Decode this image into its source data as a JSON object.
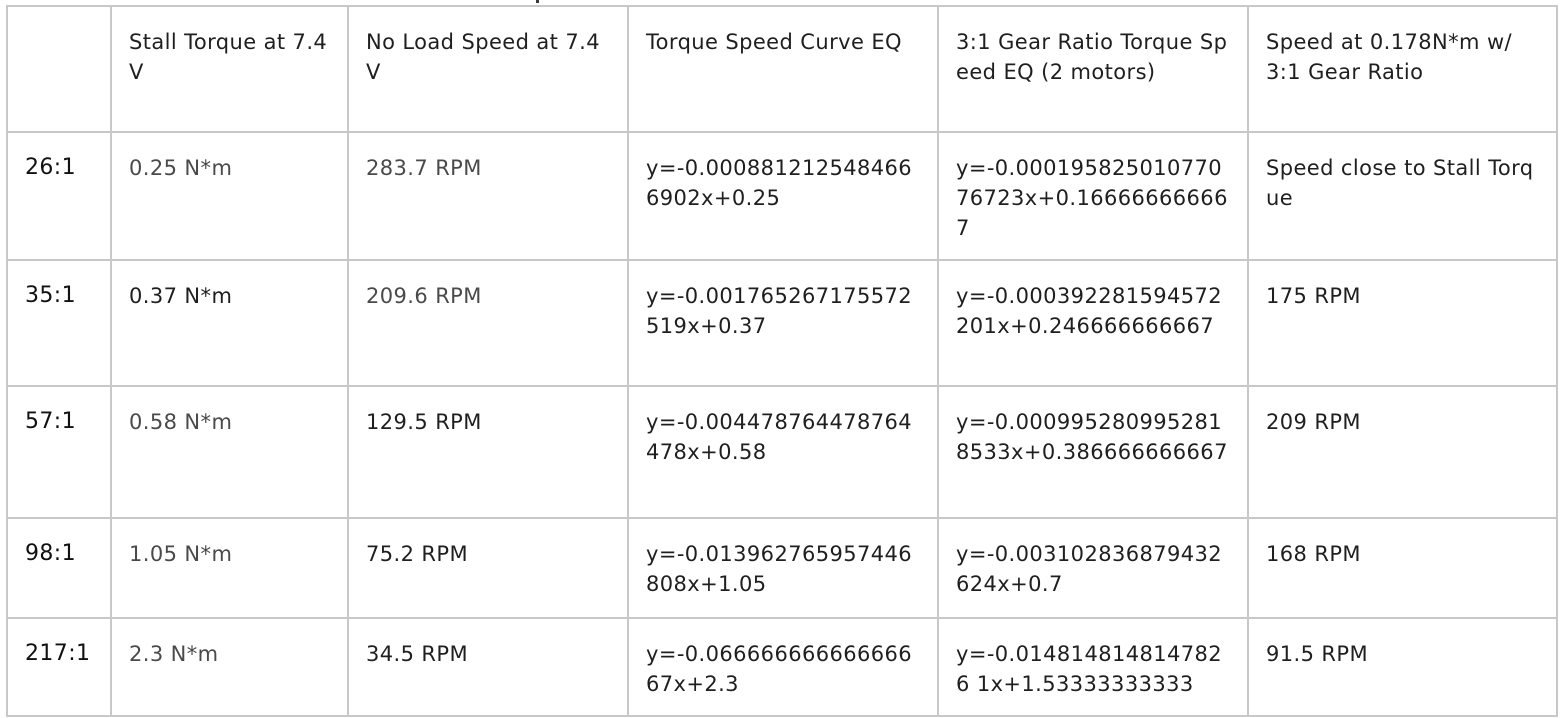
{
  "table": {
    "headers": [
      "",
      "Stall Torque at 7.4V",
      "No Load Speed at 7.4V",
      "Torque Speed Curve EQ",
      "3:1 Gear Ratio Torque Speed EQ (2 motors)",
      "Speed at  0.178N*m w/ 3:1 Gear Ratio"
    ],
    "rows": [
      [
        "26:1",
        "0.25 N*m",
        "283.7 RPM",
        "y=-0.0008812125484666902x+0.25",
        "y=-0.00019582501077076723x+0.166666666667",
        "Speed close to Stall Torque"
      ],
      [
        "35:1",
        "0.37 N*m",
        "209.6 RPM",
        "y=-0.001765267175572519x+0.37",
        "y=-0.000392281594572201x+0.246666666667",
        "175 RPM"
      ],
      [
        "57:1",
        "0.58 N*m",
        "129.5 RPM",
        "y=-0.004478764478764478x+0.58",
        "y=-0.0009952809952818533x+0.386666666667",
        "209 RPM"
      ],
      [
        "98:1",
        "1.05 N*m",
        "75.2 RPM",
        "y=-0.013962765957446808x+1.05",
        "y=-0.003102836879432624x+0.7",
        "168 RPM"
      ],
      [
        "217:1",
        "2.3 N*m",
        "34.5 RPM",
        "y=-0.06666666666666667x+2.3",
        "y=-0.0148148148147826 1x+1.53333333333",
        "91.5 RPM"
      ]
    ]
  }
}
